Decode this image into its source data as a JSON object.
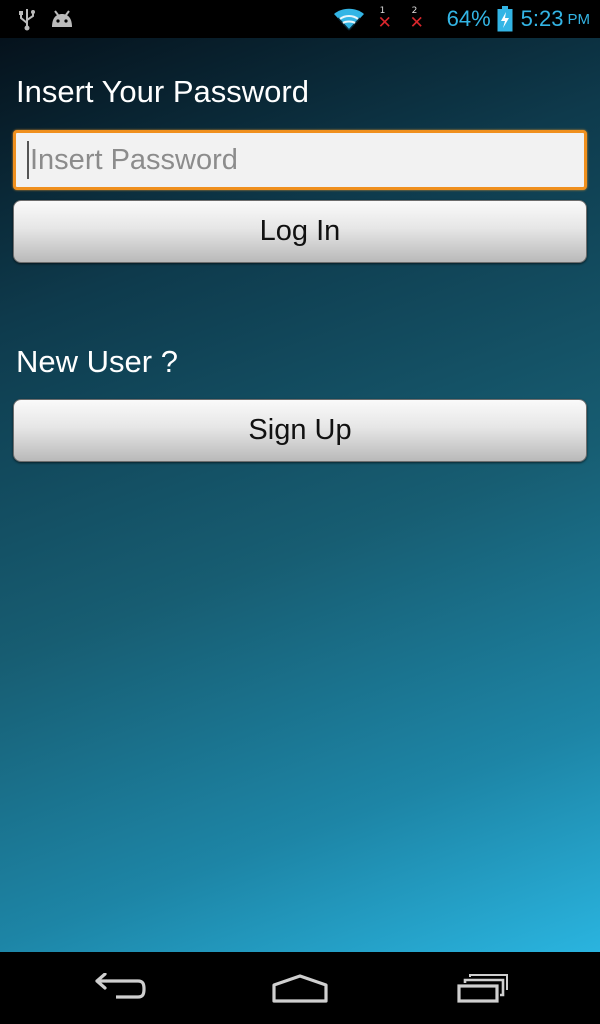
{
  "status_bar": {
    "icons_left": [
      "usb-icon",
      "android-debug-icon"
    ],
    "wifi_icon": "wifi-icon",
    "sim1": {
      "number": "1",
      "mark": "✕"
    },
    "sim2": {
      "number": "2",
      "mark": "✕"
    },
    "battery_percent": "64%",
    "battery_icon": "battery-charging-icon",
    "time": "5:23",
    "ampm": "PM",
    "accent_color": "#33b5e5"
  },
  "login": {
    "heading": "Insert Your Password",
    "password_placeholder": "Insert Password",
    "password_value": "",
    "login_button": "Log In"
  },
  "signup": {
    "heading": "New User ?",
    "signup_button": "Sign Up"
  },
  "nav_bar": {
    "icons": [
      "back-icon",
      "home-icon",
      "recent-apps-icon"
    ]
  },
  "colors": {
    "input_focus_border": "#f0901e",
    "gradient_top": "#05121c",
    "gradient_bottom": "#2ab4df"
  }
}
